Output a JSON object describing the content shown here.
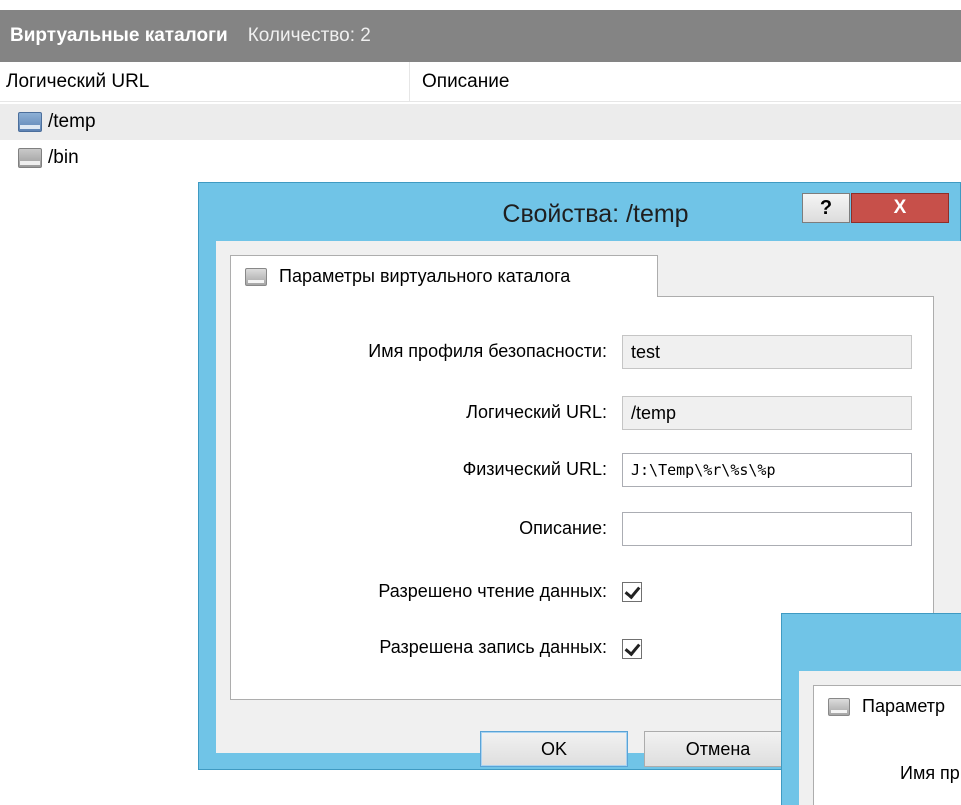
{
  "panel": {
    "title": "Виртуальные каталоги",
    "count": "Количество: 2",
    "columns": [
      "Логический URL",
      "Описание"
    ],
    "rows": [
      {
        "url": "/temp",
        "description": "",
        "icon": "folder-blue-icon"
      },
      {
        "url": "/bin",
        "description": "",
        "icon": "folder-gray-icon"
      }
    ]
  },
  "dialog": {
    "title": "Свойства: /temp",
    "help_label": "?",
    "close_label": "X",
    "tab_label": "Параметры виртуального каталога",
    "fields": {
      "profile_label": "Имя профиля безопасности:",
      "profile_value": "test",
      "logical_label": "Логический URL:",
      "logical_value": "/temp",
      "physical_label": "Физический URL:",
      "physical_value": "J:\\Temp\\%r\\%s\\%p",
      "description_label": "Описание:",
      "description_value": "",
      "read_label": "Разрешено чтение данных:",
      "read_checked": true,
      "write_label": "Разрешена запись данных:",
      "write_checked": true
    },
    "ok_label": "OK",
    "cancel_label": "Отмена"
  },
  "dialog2": {
    "tab_label": "Параметр",
    "field_label": "Имя пр"
  },
  "colors": {
    "header_bg": "#848484",
    "dialog_frame": "#70c4e7",
    "close_button": "#c7504a"
  }
}
